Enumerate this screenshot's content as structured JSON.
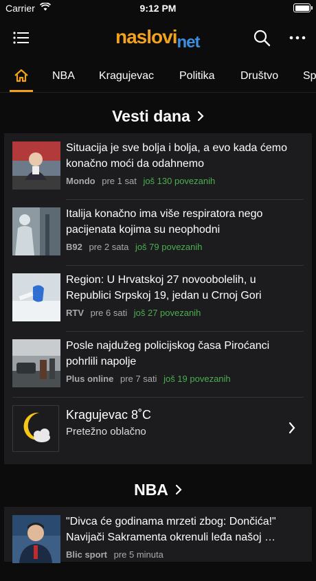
{
  "status_bar": {
    "carrier": "Carrier",
    "time": "9:12 PM"
  },
  "header": {
    "logo_part1": "naslovi",
    "logo_part2": "net",
    "accent_color": "#f3a21b",
    "icons": [
      "menu-icon",
      "search-icon",
      "more-icon"
    ]
  },
  "tabs": {
    "home_icon": "home-icon",
    "items": [
      "NBA",
      "Kragujevac",
      "Politika",
      "Društvo",
      "Sp"
    ]
  },
  "sections": [
    {
      "title": "Vesti dana",
      "news": [
        {
          "headline": "Situacija je sve bolja i bolja, a evo kada ćemo konačno moći da odahnemo",
          "source": "Mondo",
          "ago": "pre 1 sat",
          "related": "još 130 povezanih"
        },
        {
          "headline": "Italija konačno ima više respiratora nego pacijenata kojima su neophodni",
          "source": "B92",
          "ago": "pre 2 sata",
          "related": "još 79 povezanih"
        },
        {
          "headline": "Region: U Hrvatskoj 27 novoobolelih, u Republici Srpskoj 19, jedan u Crnoj Gori",
          "source": "RTV",
          "ago": "pre 6 sati",
          "related": "još 27 povezanih"
        },
        {
          "headline": "Posle najdužeg policijskog časa Piroćanci pohrlili napolje",
          "source": "Plus online",
          "ago": "pre 7 sati",
          "related": "još 19 povezanih"
        }
      ],
      "weather": {
        "city": "Kragujevac 8˚C",
        "condition": "Pretežno oblačno",
        "icon": "moon-cloud-icon"
      }
    },
    {
      "title": "NBA",
      "news": [
        {
          "headline": "\"Divca će godinama mrzeti zbog: Dončića!\" Navijači Sakramenta okrenuli leđa našoj …",
          "source": "Blic sport",
          "ago": "pre 5 minuta",
          "related": ""
        }
      ]
    }
  ]
}
